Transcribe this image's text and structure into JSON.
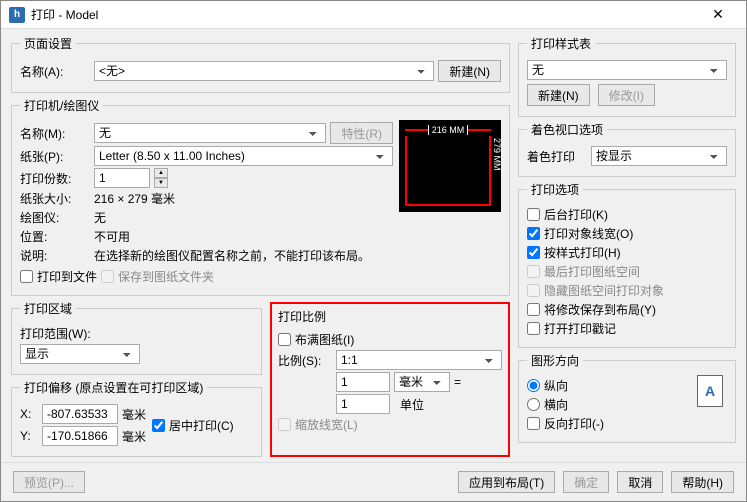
{
  "window": {
    "title": "打印 - Model"
  },
  "page_setup": {
    "legend": "页面设置",
    "name_label": "名称(A):",
    "name_value": "<无>",
    "new_btn": "新建(N)"
  },
  "printer": {
    "legend": "打印机/绘图仪",
    "name_label": "名称(M):",
    "name_value": "无",
    "props_btn": "特性(R)",
    "paper_label": "纸张(P):",
    "paper_value": "Letter (8.50 x 11.00 Inches)",
    "copies_label": "打印份数:",
    "copies_value": "1",
    "size_label": "纸张大小:",
    "size_value": "216 × 279  毫米",
    "plotter_label": "绘图仪:",
    "plotter_value": "无",
    "location_label": "位置:",
    "location_value": "不可用",
    "desc_label": "说明:",
    "desc_value": "在选择新的绘图仪配置名称之前，不能打印该布局。",
    "to_file": "打印到文件",
    "save_folder": "保存到图纸文件夹",
    "preview_w": "216 MM",
    "preview_h": "279 MM"
  },
  "area": {
    "legend": "打印区域",
    "range_label": "打印范围(W):",
    "range_value": "显示"
  },
  "scale": {
    "legend": "打印比例",
    "fit": "布满图纸(I)",
    "ratio_label": "比例(S):",
    "ratio_value": "1:1",
    "num1": "1",
    "unit1": "毫米",
    "eq": "=",
    "num2": "1",
    "unit2": "单位",
    "scale_lw": "缩放线宽(L)"
  },
  "offset": {
    "legend": "打印偏移 (原点设置在可打印区域)",
    "x_label": "X:",
    "x_value": "-807.63533",
    "y_label": "Y:",
    "y_value": "-170.51866",
    "unit": "毫米",
    "center": "居中打印(C)"
  },
  "styles": {
    "legend": "打印样式表",
    "value": "无",
    "new_btn": "新建(N)",
    "edit_btn": "修改(I)"
  },
  "viewport": {
    "legend": "着色视口选项",
    "shade_label": "着色打印",
    "shade_value": "按显示"
  },
  "options": {
    "legend": "打印选项",
    "bg": "后台打印(K)",
    "lw": "打印对象线宽(O)",
    "style": "按样式打印(H)",
    "paper_last": "最后打印图纸空间",
    "hide": "隐藏图纸空间打印对象",
    "save": "将修改保存到布局(Y)",
    "stamp": "打开打印戳记"
  },
  "orient": {
    "legend": "图形方向",
    "portrait": "纵向",
    "landscape": "横向",
    "reverse": "反向打印(-)",
    "icon": "A"
  },
  "buttons": {
    "preview": "预览(P)...",
    "apply": "应用到布局(T)",
    "ok": "确定",
    "cancel": "取消",
    "help": "帮助(H)"
  }
}
